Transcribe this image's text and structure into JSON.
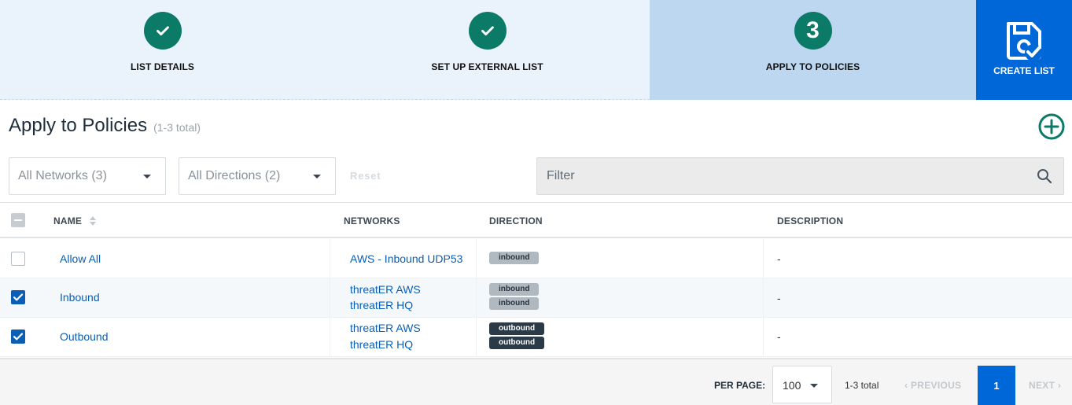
{
  "stepper": {
    "steps": [
      {
        "label": "LIST DETAILS",
        "state": "complete"
      },
      {
        "label": "SET UP EXTERNAL LIST",
        "state": "complete"
      },
      {
        "label": "APPLY TO POLICIES",
        "state": "active",
        "number": "3"
      }
    ],
    "create_button": {
      "label": "CREATE LIST",
      "icon": "save-check-icon"
    }
  },
  "header": {
    "title": "Apply to Policies",
    "subtitle": "(1-3 total)",
    "add_icon": "plus-circle-icon"
  },
  "toolbar": {
    "networks_select": "All Networks (3)",
    "directions_select": "All Directions (2)",
    "reset_label": "Reset",
    "filter_placeholder": "Filter",
    "search_icon": "search-icon"
  },
  "table": {
    "columns": [
      "NAME",
      "NETWORKS",
      "DIRECTION",
      "DESCRIPTION"
    ],
    "rows": [
      {
        "checked": false,
        "name": "Allow All",
        "networks": [
          "AWS - Inbound UDP53"
        ],
        "directions": [
          "inbound"
        ],
        "description": "-"
      },
      {
        "checked": true,
        "name": "Inbound",
        "networks": [
          "threatER AWS",
          "threatER HQ"
        ],
        "directions": [
          "inbound",
          "inbound"
        ],
        "description": "-"
      },
      {
        "checked": true,
        "name": "Outbound",
        "networks": [
          "threatER AWS",
          "threatER HQ"
        ],
        "directions": [
          "outbound",
          "outbound"
        ],
        "description": "-"
      }
    ]
  },
  "pagination": {
    "per_page_label": "PER PAGE:",
    "per_page_value": "100",
    "total": "1-3 total",
    "previous": "PREVIOUS",
    "current_page": "1",
    "next": "NEXT"
  },
  "colors": {
    "accent": "#0067d8",
    "step_complete": "#0b7a67",
    "active_step_bg": "#bcd7ef",
    "link": "#0a5fb4"
  }
}
